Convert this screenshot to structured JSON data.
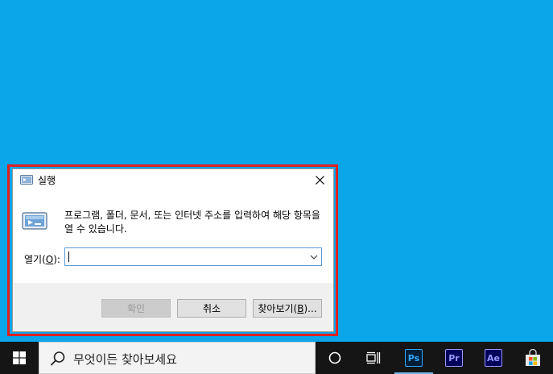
{
  "dialog": {
    "title": "실행",
    "description": "프로그램, 폴더, 문서, 또는 인터넷 주소를 입력하여 해당 항목을 열 수 있습니다.",
    "open_label_prefix": "열기(",
    "open_label_key": "O",
    "open_label_suffix": "):",
    "open_value": "",
    "ok_label": "확인",
    "cancel_label": "취소",
    "browse_prefix": "찾아보기(",
    "browse_key": "B",
    "browse_suffix": ")..."
  },
  "taskbar": {
    "search_placeholder": "무엇이든 찾아보세요",
    "apps": [
      {
        "label": "Ps",
        "bg": "#001e36",
        "fg": "#31a8ff"
      },
      {
        "label": "Pr",
        "bg": "#00005b",
        "fg": "#9999ff"
      },
      {
        "label": "Ae",
        "bg": "#00005b",
        "fg": "#9999ff"
      }
    ]
  },
  "colors": {
    "desktop": "#0ba5ea",
    "highlight": "#e0201e",
    "taskbar": "#151515"
  }
}
